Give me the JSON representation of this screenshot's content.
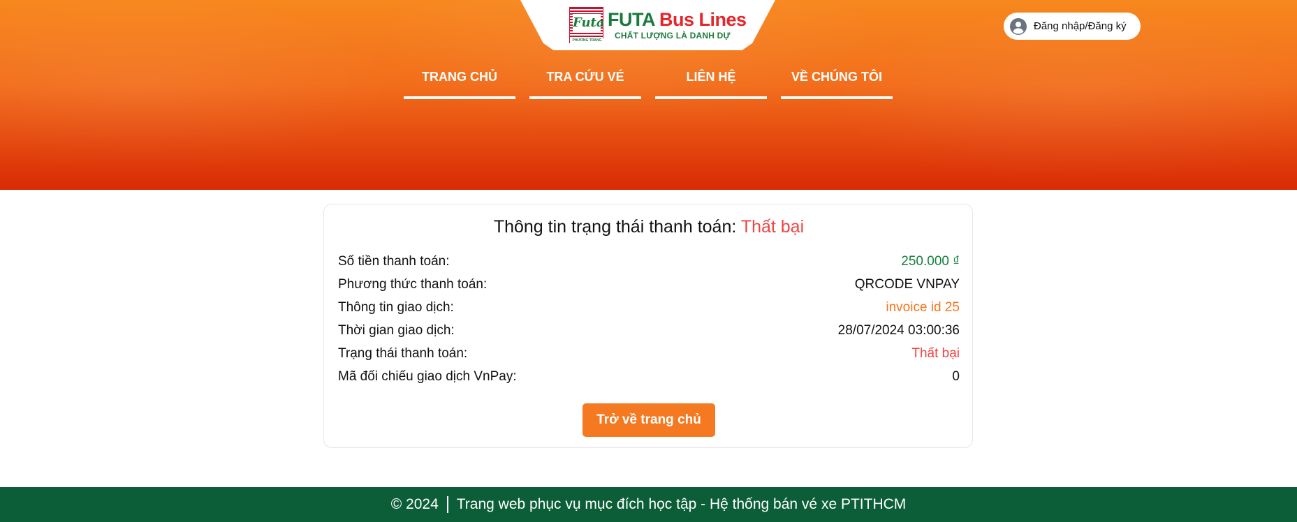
{
  "header": {
    "brand": {
      "name_part1": "FUTA",
      "name_part2": "Bus Lines",
      "tagline": "CHẤT LƯỢNG LÀ DANH DỰ",
      "mark_text": "Futa",
      "mark_subtext": "PHƯƠNG TRANG"
    },
    "login_label": "Đăng nhập/Đăng ký",
    "nav": [
      {
        "label": "TRANG CHỦ"
      },
      {
        "label": "TRA CỨU VÉ"
      },
      {
        "label": "LIÊN HỆ"
      },
      {
        "label": "VỀ CHÚNG TÔI"
      }
    ]
  },
  "payment": {
    "title_prefix": "Thông tin trạng thái thanh toán:",
    "title_status": "Thất bại",
    "rows": [
      {
        "label": "Số tiền thanh toán:",
        "value": "250.000 ₫"
      },
      {
        "label": "Phương thức thanh toán:",
        "value": "QRCODE VNPAY"
      },
      {
        "label": "Thông tin giao dịch:",
        "value": "invoice id 25"
      },
      {
        "label": "Thời gian giao dịch:",
        "value": "28/07/2024 03:00:36"
      },
      {
        "label": "Trạng thái thanh toán:",
        "value": "Thất bại"
      },
      {
        "label": "Mã đối chiếu giao dịch VnPay:",
        "value": "0"
      }
    ],
    "back_button": "Trở về trang chủ"
  },
  "footer": {
    "copyright": "© 2024",
    "text": "Trang web phục vụ mục đích học tập - Hệ thống bán vé xe PTITHCM"
  },
  "colors": {
    "header_top": "#f7881f",
    "header_bottom": "#d92a05",
    "brand_green": "#1a7a3c",
    "brand_red": "#e5252a",
    "fail_red": "#ef4444",
    "amount_green": "#15803d",
    "info_orange": "#f97316",
    "button_orange": "#f47920",
    "footer_green": "#0b5e38"
  }
}
